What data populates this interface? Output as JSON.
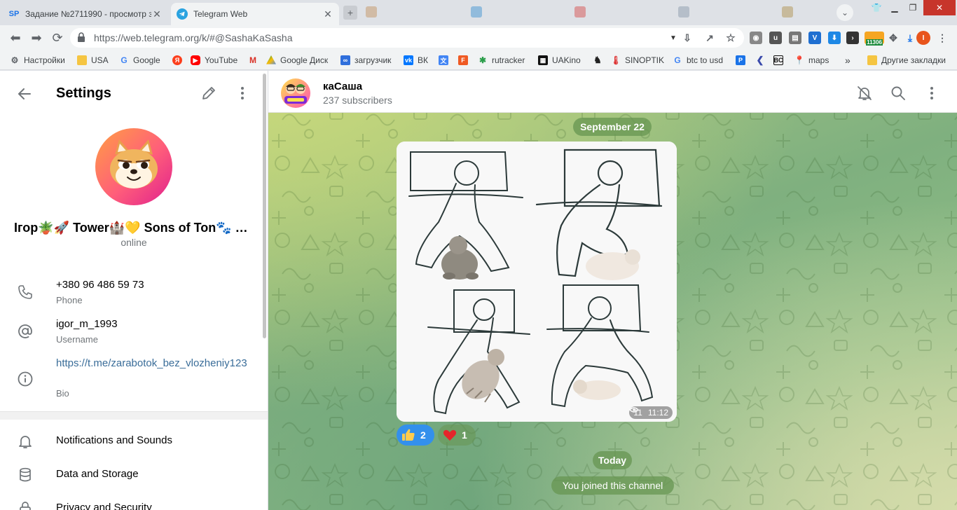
{
  "browser": {
    "tabs": [
      {
        "title": "Задание №2711990 - просмотр з",
        "favicon": "SP"
      },
      {
        "title": "Telegram Web",
        "favicon": "telegram"
      }
    ],
    "url": "https://web.telegram.org/k/#@SashaKaSasha",
    "bookmarks": [
      {
        "label": "Настройки",
        "icon": "gear-icon"
      },
      {
        "label": "USA",
        "icon": "folder-icon"
      },
      {
        "label": "Google",
        "icon": "google-icon"
      },
      {
        "label": "",
        "icon": "yandex-icon"
      },
      {
        "label": "YouTube",
        "icon": "youtube-icon"
      },
      {
        "label": "",
        "icon": "gmail-icon"
      },
      {
        "label": "Google Диск",
        "icon": "drive-icon"
      },
      {
        "label": "загрузчик",
        "icon": "infinity-icon"
      },
      {
        "label": "ВК",
        "icon": "vk-icon"
      },
      {
        "label": "",
        "icon": "translate-icon"
      },
      {
        "label": "",
        "icon": "f-icon"
      },
      {
        "label": "rutracker",
        "icon": "rutracker-icon"
      },
      {
        "label": "UAKino",
        "icon": "uakino-icon"
      },
      {
        "label": "",
        "icon": "chess-icon"
      },
      {
        "label": "SINOPTIK",
        "icon": "thermometer-icon"
      },
      {
        "label": "btc to usd",
        "icon": "google-icon"
      },
      {
        "label": "",
        "icon": "p-icon"
      },
      {
        "label": "",
        "icon": "arrow-icon"
      },
      {
        "label": "",
        "icon": "bc-icon"
      },
      {
        "label": "maps",
        "icon": "maps-icon"
      }
    ],
    "more_bookmarks": "»",
    "other_bookmarks": "Другие закладки",
    "extension_badge": "11306",
    "profile_initial": "I"
  },
  "settings": {
    "title": "Settings",
    "profile_name": "Ігор🪴🚀 Tower🏰💛 Sons of Ton🐾 @…",
    "profile_status": "online",
    "phone": {
      "value": "+380 96 486 59 73",
      "label": "Phone"
    },
    "username": {
      "value": "igor_m_1993",
      "label": "Username"
    },
    "bio": {
      "value": "https://t.me/zarabotok_bez_vlozheniy123",
      "label": "Bio"
    },
    "menu": [
      {
        "label": "Notifications and Sounds",
        "icon": "bell-icon"
      },
      {
        "label": "Data and Storage",
        "icon": "database-icon"
      },
      {
        "label": "Privacy and Security",
        "icon": "lock-icon"
      }
    ]
  },
  "chat": {
    "name": "каСаша",
    "subscribers": "237 subscribers",
    "date_pill": "September 22",
    "message": {
      "views": "11",
      "time": "11:12"
    },
    "reactions": [
      {
        "emoji": "thumbs-up",
        "count": "2"
      },
      {
        "emoji": "heart",
        "count": "1"
      }
    ],
    "today_pill": "Today",
    "service_message": "You joined this channel"
  },
  "colors": {
    "accent": "#3390ec",
    "link": "#3a6d99",
    "secondary_text": "#707579",
    "pill": "#679652"
  }
}
